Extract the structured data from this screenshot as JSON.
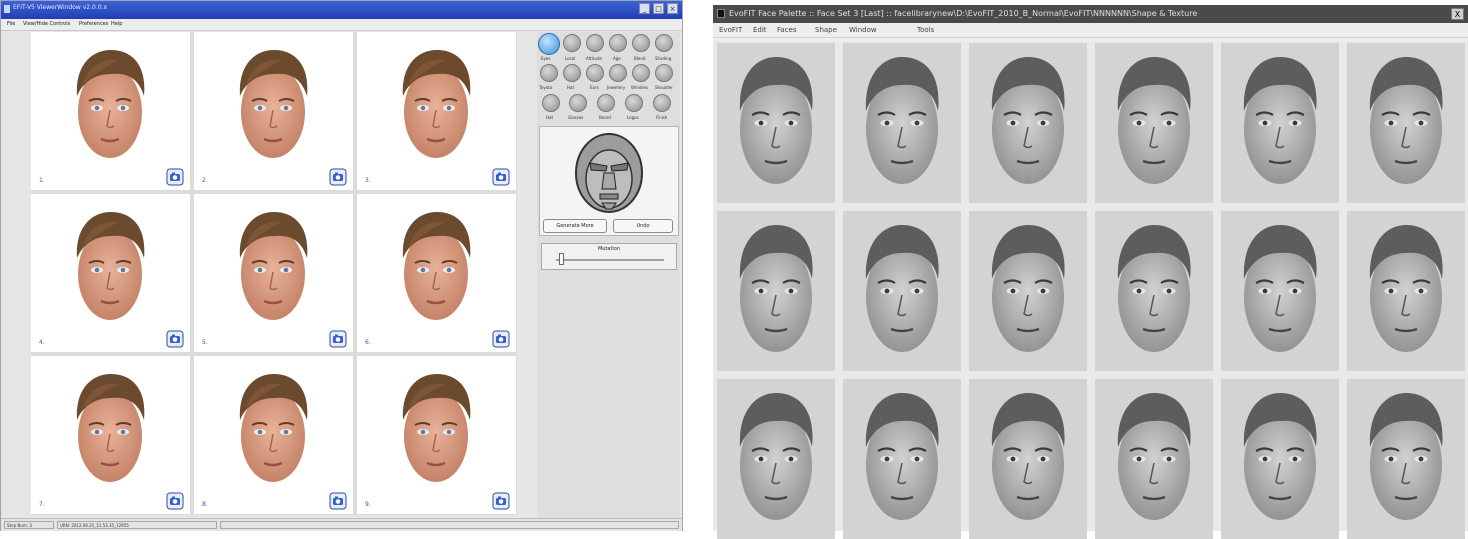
{
  "left_window": {
    "title": "EFIT-V5 ViewerWindow v2.0.0.x",
    "menu": [
      "File",
      "View/Hide Controls",
      "Preferences",
      "Help"
    ],
    "faces": [
      {
        "number": "1."
      },
      {
        "number": "2."
      },
      {
        "number": "3."
      },
      {
        "number": "4."
      },
      {
        "number": "5."
      },
      {
        "number": "6."
      },
      {
        "number": "7."
      },
      {
        "number": "8."
      },
      {
        "number": "9."
      }
    ],
    "feature_labels_row1": [
      "Eyes",
      "Local",
      "Attitude",
      "Age",
      "Blend",
      "Shading"
    ],
    "feature_labels_row2": [
      "Toyota",
      "Hat",
      "Ears",
      "Jewellery",
      "Wrinkles",
      "Shoulder"
    ],
    "feature_labels_row3": [
      "Hat",
      "Glasses",
      "Beard",
      "Logos",
      "Finish"
    ],
    "generate_button": "Generate More",
    "undo_button": "Undo",
    "mutation_label": "Mutation",
    "mutation_value": 0.05,
    "status": {
      "step": "Step Num: 3",
      "url": "URN: 2012.06.25_11.53.35_12955"
    },
    "colors": {
      "titlebar": "#2a4cc4",
      "selected_feature": "#3c8fd8",
      "face_number": "#3752c8"
    }
  },
  "right_window": {
    "title": "EvoFIT Face Palette :: Face Set 3 [Last] :: facelibrarynew\\D:\\EvoFIT_2010_B_Normal\\EvoFIT\\NNNNNN\\Shape & Texture",
    "close": "X",
    "menu": [
      "EvoFIT",
      "Edit",
      "Faces",
      "Shape",
      "Window",
      "Tools"
    ],
    "grid": {
      "rows": 3,
      "columns": 6
    }
  }
}
